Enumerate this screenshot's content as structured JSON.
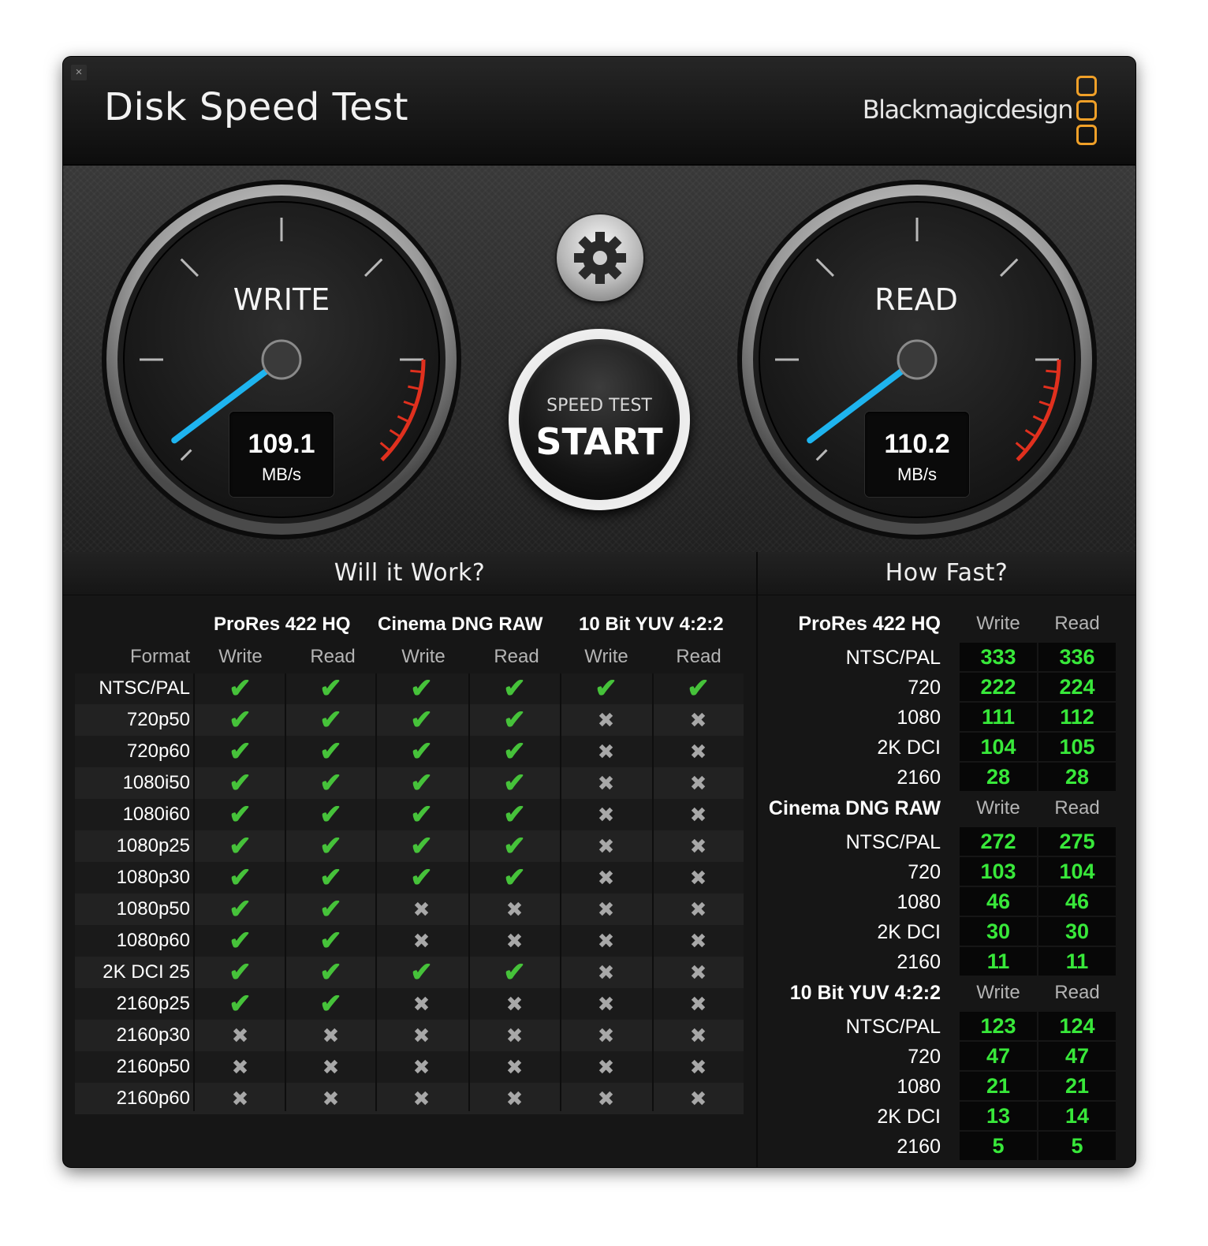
{
  "window": {
    "close_icon": "×",
    "title": "Disk Speed Test",
    "brand": "Blackmagicdesign",
    "brand_icon": "blackmagic-logo"
  },
  "gauges": {
    "write": {
      "label": "WRITE",
      "value": "109.1",
      "unit": "MB/s"
    },
    "read": {
      "label": "READ",
      "value": "110.2",
      "unit": "MB/s"
    },
    "needle_color": "#1eb4ef",
    "redline_color": "#e0301e"
  },
  "controls": {
    "settings_icon": "gear-icon",
    "start_small": "SPEED TEST",
    "start_big": "START"
  },
  "will_it_work": {
    "title": "Will it Work?",
    "format_label": "Format",
    "codecs": [
      "ProRes 422 HQ",
      "Cinema DNG RAW",
      "10 Bit YUV 4:2:2"
    ],
    "subheaders": [
      "Write",
      "Read",
      "Write",
      "Read",
      "Write",
      "Read"
    ],
    "rows": [
      {
        "format": "NTSC/PAL",
        "marks": [
          "✔",
          "✔",
          "✔",
          "✔",
          "✔",
          "✔"
        ]
      },
      {
        "format": "720p50",
        "marks": [
          "✔",
          "✔",
          "✔",
          "✔",
          "✖",
          "✖"
        ]
      },
      {
        "format": "720p60",
        "marks": [
          "✔",
          "✔",
          "✔",
          "✔",
          "✖",
          "✖"
        ]
      },
      {
        "format": "1080i50",
        "marks": [
          "✔",
          "✔",
          "✔",
          "✔",
          "✖",
          "✖"
        ]
      },
      {
        "format": "1080i60",
        "marks": [
          "✔",
          "✔",
          "✔",
          "✔",
          "✖",
          "✖"
        ]
      },
      {
        "format": "1080p25",
        "marks": [
          "✔",
          "✔",
          "✔",
          "✔",
          "✖",
          "✖"
        ]
      },
      {
        "format": "1080p30",
        "marks": [
          "✔",
          "✔",
          "✔",
          "✔",
          "✖",
          "✖"
        ]
      },
      {
        "format": "1080p50",
        "marks": [
          "✔",
          "✔",
          "✖",
          "✖",
          "✖",
          "✖"
        ]
      },
      {
        "format": "1080p60",
        "marks": [
          "✔",
          "✔",
          "✖",
          "✖",
          "✖",
          "✖"
        ]
      },
      {
        "format": "2K DCI 25",
        "marks": [
          "✔",
          "✔",
          "✔",
          "✔",
          "✖",
          "✖"
        ]
      },
      {
        "format": "2160p25",
        "marks": [
          "✔",
          "✔",
          "✖",
          "✖",
          "✖",
          "✖"
        ]
      },
      {
        "format": "2160p30",
        "marks": [
          "✖",
          "✖",
          "✖",
          "✖",
          "✖",
          "✖"
        ]
      },
      {
        "format": "2160p50",
        "marks": [
          "✖",
          "✖",
          "✖",
          "✖",
          "✖",
          "✖"
        ]
      },
      {
        "format": "2160p60",
        "marks": [
          "✖",
          "✖",
          "✖",
          "✖",
          "✖",
          "✖"
        ]
      }
    ]
  },
  "how_fast": {
    "title": "How Fast?",
    "write_label": "Write",
    "read_label": "Read",
    "groups": [
      {
        "codec": "ProRes 422 HQ",
        "rows": [
          {
            "format": "NTSC/PAL",
            "write": "333",
            "read": "336"
          },
          {
            "format": "720",
            "write": "222",
            "read": "224"
          },
          {
            "format": "1080",
            "write": "111",
            "read": "112"
          },
          {
            "format": "2K DCI",
            "write": "104",
            "read": "105"
          },
          {
            "format": "2160",
            "write": "28",
            "read": "28"
          }
        ]
      },
      {
        "codec": "Cinema DNG RAW",
        "rows": [
          {
            "format": "NTSC/PAL",
            "write": "272",
            "read": "275"
          },
          {
            "format": "720",
            "write": "103",
            "read": "104"
          },
          {
            "format": "1080",
            "write": "46",
            "read": "46"
          },
          {
            "format": "2K DCI",
            "write": "30",
            "read": "30"
          },
          {
            "format": "2160",
            "write": "11",
            "read": "11"
          }
        ]
      },
      {
        "codec": "10 Bit YUV 4:2:2",
        "rows": [
          {
            "format": "NTSC/PAL",
            "write": "123",
            "read": "124"
          },
          {
            "format": "720",
            "write": "47",
            "read": "47"
          },
          {
            "format": "1080",
            "write": "21",
            "read": "21"
          },
          {
            "format": "2K DCI",
            "write": "13",
            "read": "14"
          },
          {
            "format": "2160",
            "write": "5",
            "read": "5"
          }
        ]
      }
    ]
  }
}
